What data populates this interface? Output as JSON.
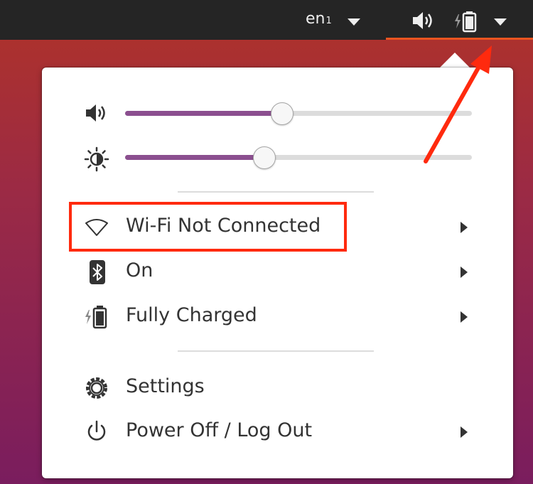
{
  "topbar": {
    "language": "en",
    "language_subscript": "1",
    "icons": [
      "volume-icon",
      "battery-charging-icon",
      "system-menu-caret-icon"
    ]
  },
  "system_menu": {
    "sliders": [
      {
        "name": "volume",
        "icon": "volume-icon",
        "level_percent": 45
      },
      {
        "name": "brightness",
        "icon": "brightness-icon",
        "level_percent": 40
      }
    ],
    "items": [
      {
        "label": "Wi-Fi Not Connected",
        "icon": "wifi-icon",
        "has_submenu": true,
        "highlighted": true
      },
      {
        "label": "On",
        "icon": "bluetooth-icon",
        "has_submenu": true
      },
      {
        "label": "Fully Charged",
        "icon": "battery-charging-icon",
        "has_submenu": true
      },
      {
        "label": "Settings",
        "icon": "settings-gear-icon",
        "has_submenu": false
      },
      {
        "label": "Power Off / Log Out",
        "icon": "power-icon",
        "has_submenu": true
      }
    ]
  },
  "annotations": {
    "highlight_color": "#ff2a0e",
    "arrow_color": "#ff2a0e"
  },
  "colors": {
    "accent": "#e95420",
    "slider_fill": "#8b4f8f",
    "topbar": "#252525"
  }
}
